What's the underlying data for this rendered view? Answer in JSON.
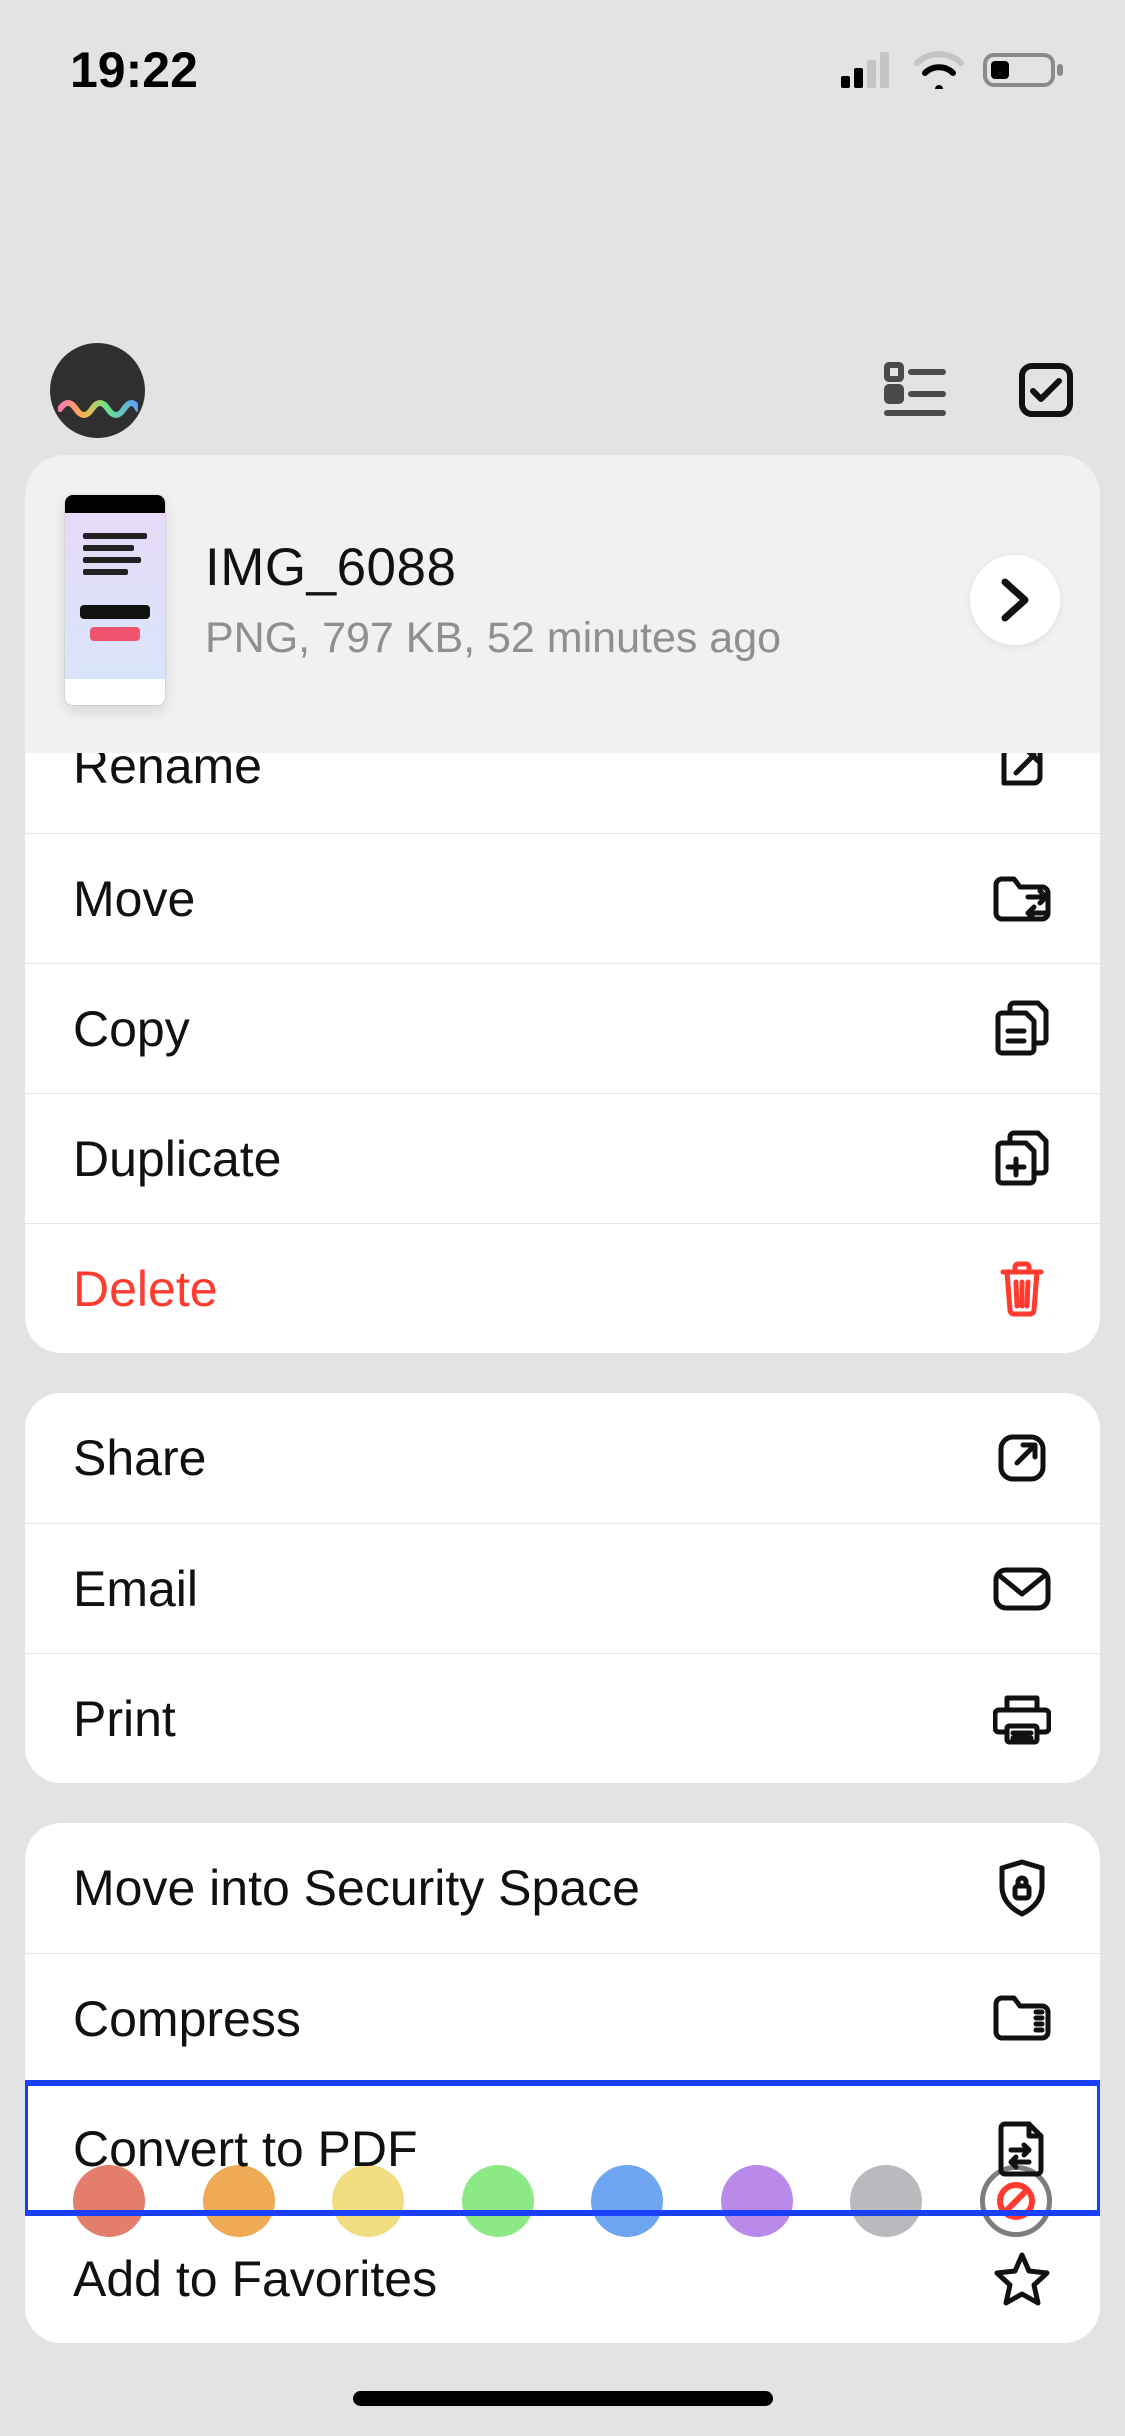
{
  "status": {
    "time": "19:22"
  },
  "file": {
    "name": "IMG_6088",
    "subtitle": "PNG, 797 KB, 52 minutes ago"
  },
  "menu": {
    "group1": {
      "rename": "Rename",
      "move": "Move",
      "copy": "Copy",
      "duplicate": "Duplicate",
      "delete": "Delete"
    },
    "group2": {
      "share": "Share",
      "email": "Email",
      "print": "Print"
    },
    "group3": {
      "security": "Move into Security Space",
      "compress": "Compress",
      "convert": "Convert to PDF",
      "favorite": "Add to Favorites"
    }
  },
  "swatches": {
    "colors": [
      "#e47e6c",
      "#efaa56",
      "#f1dd81",
      "#8de986",
      "#6ea4f0",
      "#b98ae9",
      "#b9b9be"
    ]
  }
}
